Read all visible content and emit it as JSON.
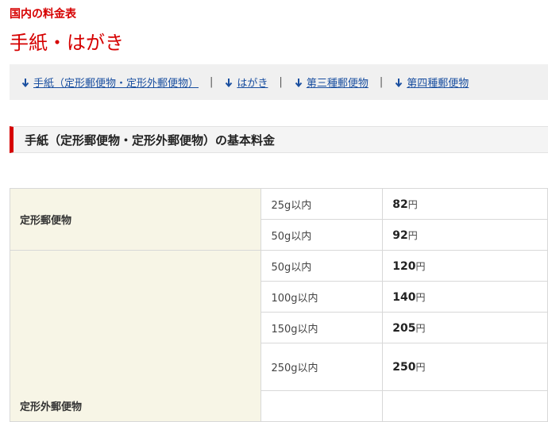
{
  "breadcrumb": "国内の料金表",
  "page_title": "手紙・はがき",
  "nav": {
    "items": [
      {
        "label": "手紙（定形郵便物・定形外郵便物）"
      },
      {
        "label": "はがき"
      },
      {
        "label": "第三種郵便物"
      },
      {
        "label": "第四種郵便物"
      }
    ],
    "separator": "|"
  },
  "section_heading": "手紙（定形郵便物・定形外郵便物）の基本料金",
  "table": {
    "yen_suffix": "円",
    "groups": [
      {
        "category": "定形郵便物",
        "rows": [
          {
            "weight": "25g以内",
            "price": "82"
          },
          {
            "weight": "50g以内",
            "price": "92"
          }
        ]
      },
      {
        "category": "定形外郵便物",
        "rows": [
          {
            "weight": "50g以内",
            "price": "120"
          },
          {
            "weight": "100g以内",
            "price": "140"
          },
          {
            "weight": "150g以内",
            "price": "205"
          },
          {
            "weight": "250g以内",
            "price": "250"
          }
        ]
      }
    ]
  },
  "colors": {
    "accent_red": "#d60000",
    "link_blue": "#1a4fa0",
    "category_bg": "#f7f5e6"
  }
}
